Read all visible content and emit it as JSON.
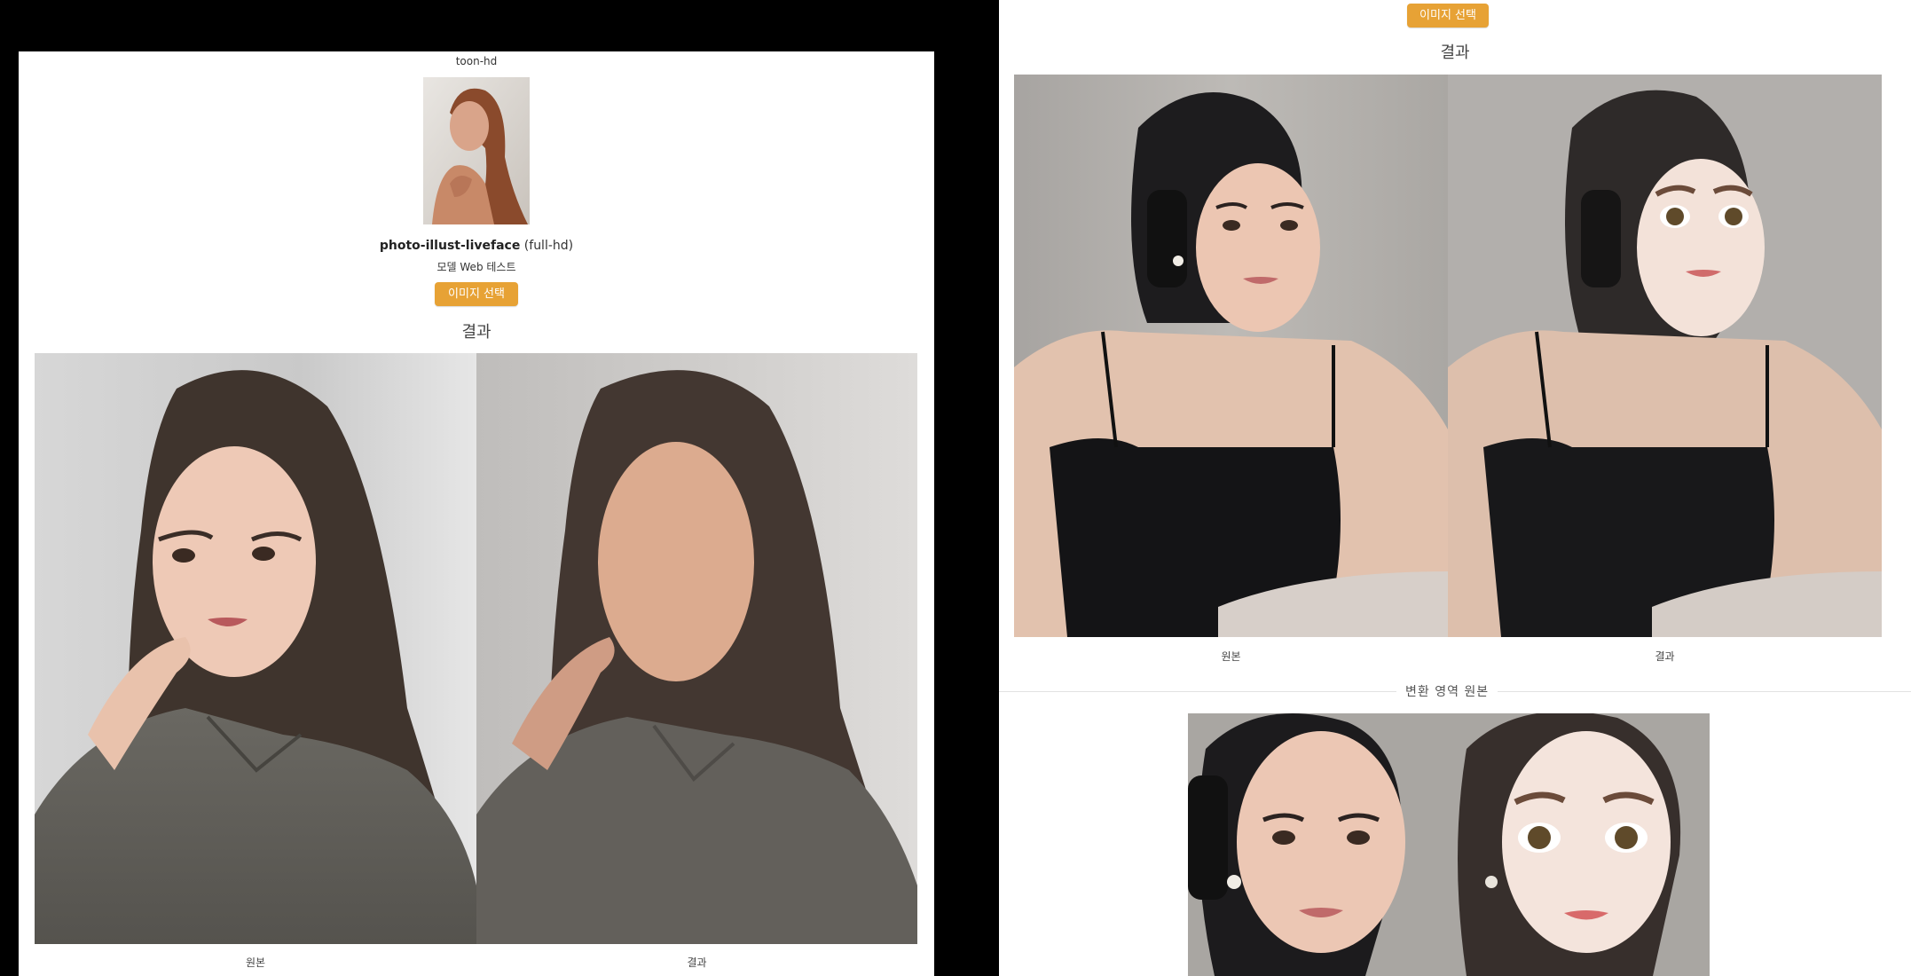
{
  "left_panel": {
    "model_id_label": "toon-hd",
    "model_name": "photo-illust-liveface",
    "model_suffix": "(full-hd)",
    "test_label": "모델 Web 테스트",
    "select_button": "이미지 선택",
    "result_heading": "결과",
    "caption_original": "원본",
    "caption_result": "결과"
  },
  "right_panel": {
    "select_button": "이미지 선택",
    "result_heading": "결과",
    "caption_original": "원본",
    "caption_result": "결과",
    "section_divider": "변환 영역 원본"
  },
  "colors": {
    "accent_button": "#e7a235",
    "background": "#000000",
    "panel": "#ffffff"
  }
}
